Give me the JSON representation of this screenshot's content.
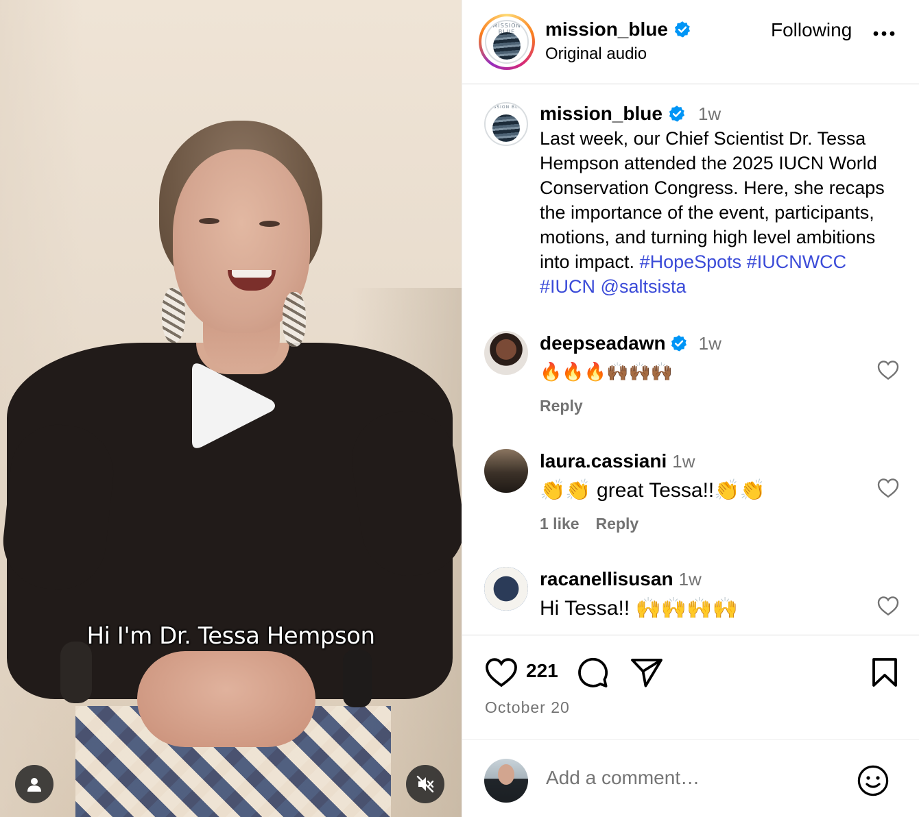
{
  "video": {
    "caption_overlay": "Hi I'm Dr. Tessa Hempson"
  },
  "header": {
    "username": "mission_blue",
    "subtitle": "Original audio",
    "follow_label": "Following",
    "logo_text": "MISSION BLUE"
  },
  "post": {
    "username": "mission_blue",
    "time": "1w",
    "caption_text": "Last week, our Chief Scientist Dr. Tessa Hempson attended the 2025 IUCN World Conservation Congress. Here, she recaps the importance of the event, participants, motions, and turning high level ambitions into impact. ",
    "hashtags": [
      "#HopeSpots",
      "#IUCNWCC",
      "#IUCN",
      "@saltsista"
    ]
  },
  "comments": [
    {
      "username": "deepseadawn",
      "verified": true,
      "time": "1w",
      "text": "🔥🔥🔥🙌🏾🙌🏾🙌🏾",
      "likes_label": "",
      "reply_label": "Reply"
    },
    {
      "username": "laura.cassiani",
      "verified": false,
      "time": "1w",
      "text": "👏👏 great Tessa!!👏👏",
      "likes_label": "1 like",
      "reply_label": "Reply"
    },
    {
      "username": "racanellisusan",
      "verified": false,
      "time": "1w",
      "text": "Hi Tessa!! 🙌🙌🙌🙌",
      "likes_label": "",
      "reply_label": ""
    }
  ],
  "actions": {
    "like_count": "221",
    "date": "October 20"
  },
  "composer": {
    "placeholder": "Add a comment…"
  },
  "colors": {
    "link": "#3b4bd8",
    "verified": "#0095f6",
    "muted": "#737373"
  }
}
